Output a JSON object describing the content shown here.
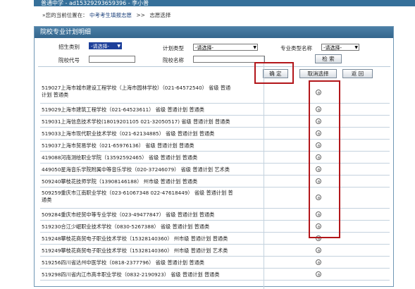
{
  "header": {
    "user_text": "普通中学 - ad15329293659396 - 李小普"
  },
  "breadcrumb": {
    "prefix": "»您的当前位置在：",
    "level1": "中考考生填报志愿",
    "separator": ">>",
    "level2": "志愿选择"
  },
  "panel": {
    "title": "院校专业计划明细"
  },
  "filters": {
    "enroll_type_label": "招生类别",
    "enroll_type_value": "-请选择-",
    "plan_type_label": "计划类型",
    "plan_type_value": "-请选择-",
    "major_type_label": "专业类型名称",
    "major_type_value": "-请选择-",
    "school_code_label": "院校代号",
    "school_code_value": "",
    "school_name_label": "院校名称",
    "school_name_value": ""
  },
  "buttons": {
    "search": "检 索",
    "confirm": "确 定",
    "cancel_select": "取消选择",
    "back": "返 回"
  },
  "rows": [
    {
      "line1": "519027上海市城市建设工程学校（上海市园林学校）（021-64572540）  省级   普通",
      "line2": "计划   普通类"
    },
    {
      "line1": "519029上海市建筑工程学校（021-64523611）   省级   普通计划   普通类",
      "line2": ""
    },
    {
      "line1": "519031上海信息技术学校(18019201105 021-32050517)   省级   普通计划   普通类",
      "line2": ""
    },
    {
      "line1": "519033上海市现代职业技术学校（021-62134885）   省级   普通计划   普通类",
      "line2": ""
    },
    {
      "line1": "519037上海市贸易学校（021-65976136）   省级   普通计划   普通类",
      "line2": ""
    },
    {
      "line1": "419088河南测绘职业学院（13592592465）   省级   普通计划   普通类",
      "line2": ""
    },
    {
      "line1": "449050星海音乐学院附属中等音乐学校（020-37246079）   省级   普通计划   艺术类",
      "line2": ""
    },
    {
      "line1": "509240攀枝花技师学院（13908146188）   州市级   普通计划   普通类",
      "line2": ""
    },
    {
      "line1": "509259重庆市江南职业学校（023-61067348 022-47618449）   省级   普通计划   普",
      "line2": "通类"
    },
    {
      "line1": "509284重庆市经贸中等专业学校（023-49477847）   省级   普通计划   普通类",
      "line2": ""
    },
    {
      "line1": "519230合江少岷职业技术学校（0830-5267388）   省级   普通计划   普通类",
      "line2": ""
    },
    {
      "line1": "519248攀枝花商贸电子职业技术学校（15328140360）   州市级   普通计划   普通类",
      "line2": ""
    },
    {
      "line1": "519249攀枝花商贸电子职业技术学校（15328140360）   州市级   普通计划   艺术类",
      "line2": ""
    },
    {
      "line1": "519256四川省达州中医学校（0818-2377796）   省级   普通计划   普通类",
      "line2": ""
    },
    {
      "line1": "519298四川省内江市高丰职业学校（0832-2190923）   省级   普通计划   普通类",
      "line2": ""
    }
  ]
}
